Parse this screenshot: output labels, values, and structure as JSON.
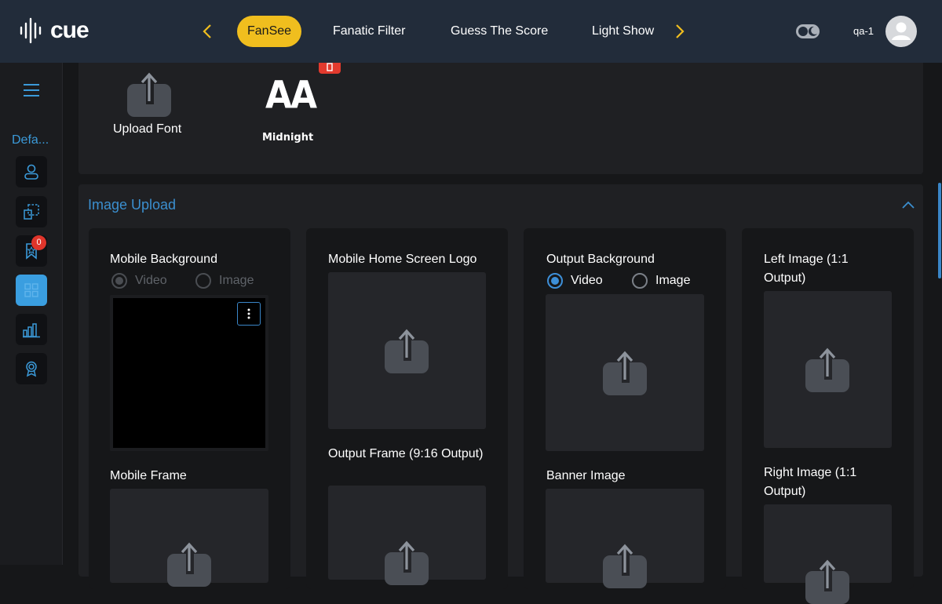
{
  "header": {
    "logo_text": "cue",
    "tabs": [
      {
        "label": "FanSee",
        "active": true
      },
      {
        "label": "Fanatic Filter",
        "active": false
      },
      {
        "label": "Guess The Score",
        "active": false
      },
      {
        "label": "Light Show",
        "active": false
      }
    ],
    "user_name": "qa-1"
  },
  "sidebar": {
    "label": "Defa...",
    "badge_count": "0"
  },
  "fonts": {
    "upload_label": "Upload Font",
    "font_preview": "AA",
    "font_name": "Midnight"
  },
  "image_upload": {
    "title": "Image Upload",
    "mobile_background": {
      "label": "Mobile Background",
      "options": [
        "Video",
        "Image"
      ],
      "selected": "Video",
      "disabled": true
    },
    "mobile_home_logo": {
      "label": "Mobile Home Screen Logo"
    },
    "output_background": {
      "label": "Output Background",
      "options": [
        "Video",
        "Image"
      ],
      "selected": "Video"
    },
    "left_image": {
      "label": "Left Image (1:1 Output)"
    },
    "mobile_frame": {
      "label": "Mobile Frame"
    },
    "output_frame": {
      "label": "Output Frame (9:16 Output)"
    },
    "banner_image": {
      "label": "Banner Image"
    },
    "right_image": {
      "label": "Right Image (1:1 Output)"
    }
  },
  "colors": {
    "accent_yellow": "#f0be1e",
    "accent_blue": "#3b9ad9",
    "header_bg": "#222c3a",
    "danger": "#e0352b"
  }
}
